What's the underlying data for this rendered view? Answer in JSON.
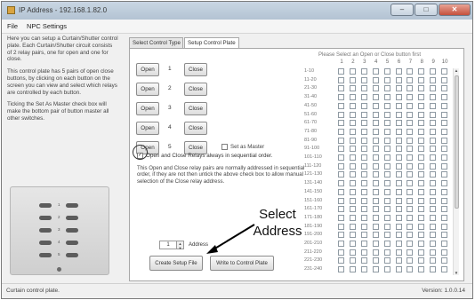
{
  "window": {
    "title": "IP Address - 192.168.1.82.0",
    "minimize": "–",
    "maximize": "□",
    "close": "✕"
  },
  "menu": {
    "file": "File",
    "settings": "NPC Settings"
  },
  "help": [
    "Here you can setup a Curtain/Shutter control plate. Each Curtain/Shutter circuit consists of 2 relay pairs, one for open and one for close.",
    "This control plate has 5 pairs of open close buttons, by clicking on each button on the screen you can view and select which relays are controlled by each button.",
    "Ticking the Set As Master check box will make the bottom pair of button master all other switches."
  ],
  "plate": {
    "numbers": [
      "1",
      "2",
      "3",
      "4",
      "5"
    ]
  },
  "tabs": {
    "setup": "Select Control Type",
    "plate": "Setup Control Plate"
  },
  "pairs": [
    {
      "open": "Open",
      "num": "1",
      "close": "Close"
    },
    {
      "open": "Open",
      "num": "2",
      "close": "Close"
    },
    {
      "open": "Open",
      "num": "3",
      "close": "Close"
    },
    {
      "open": "Open",
      "num": "4",
      "close": "Close"
    },
    {
      "open": "Open",
      "num": "5",
      "close": "Close"
    }
  ],
  "set_master": "Set as Master",
  "sequential": "Open and Close Relays always in sequential order.",
  "sequential_note": "This Open and Close relay pairs are normally addressed in sequential order, if they are not then untick the above check box to allow manual selection of the Close relay address.",
  "address": {
    "value": "1",
    "label": "Address"
  },
  "buttons": {
    "create": "Create Setup File",
    "write": "Write to Control Plate"
  },
  "grid": {
    "heading": "Please Select an Open or Close button first",
    "columns": [
      "1",
      "2",
      "3",
      "4",
      "5",
      "6",
      "7",
      "8",
      "9",
      "10"
    ],
    "rows": [
      "1-10",
      "11-20",
      "21-30",
      "31-40",
      "41-50",
      "51-60",
      "61-70",
      "71-80",
      "81-90",
      "91-100",
      "101-110",
      "111-120",
      "121-130",
      "131-140",
      "141-150",
      "151-160",
      "161-170",
      "171-180",
      "181-190",
      "191-200",
      "201-210",
      "211-220",
      "221-230",
      "231-240"
    ]
  },
  "callout": "Select Address",
  "status": {
    "left": "Curtain control plate.",
    "right": "Version: 1.0.0.14"
  }
}
